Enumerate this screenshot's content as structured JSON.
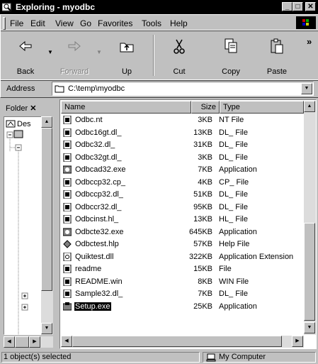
{
  "window": {
    "title": "Exploring - myodbc"
  },
  "caption_buttons": {
    "minimize": "_",
    "maximize": "□",
    "close": "✕"
  },
  "menu": [
    {
      "label": "File"
    },
    {
      "label": "Edit"
    },
    {
      "label": "View"
    },
    {
      "label": "Go"
    },
    {
      "label": "Favorites"
    },
    {
      "label": "Tools"
    },
    {
      "label": "Help"
    }
  ],
  "toolbar": {
    "back": {
      "label": "Back"
    },
    "forward": {
      "label": "Forward"
    },
    "up": {
      "label": "Up"
    },
    "cut": {
      "label": "Cut"
    },
    "copy": {
      "label": "Copy"
    },
    "paste": {
      "label": "Paste"
    },
    "more": "»"
  },
  "address": {
    "label": "Address",
    "value": "C:\\temp\\myodbc"
  },
  "folder_pane": {
    "header": "Folder",
    "close": "✕",
    "tree_item": "Des"
  },
  "columns": {
    "name": "Name",
    "size": "Size",
    "type": "Type"
  },
  "files": [
    {
      "name": "Odbc.nt",
      "size": "3KB",
      "type": "NT File",
      "icon": "generic-file-icon"
    },
    {
      "name": "Odbc16gt.dl_",
      "size": "13KB",
      "type": "DL_ File",
      "icon": "generic-file-icon"
    },
    {
      "name": "Odbc32.dl_",
      "size": "31KB",
      "type": "DL_ File",
      "icon": "generic-file-icon"
    },
    {
      "name": "Odbc32gt.dl_",
      "size": "3KB",
      "type": "DL_ File",
      "icon": "generic-file-icon"
    },
    {
      "name": "Odbcad32.exe",
      "size": "7KB",
      "type": "Application",
      "icon": "application-icon"
    },
    {
      "name": "Odbccp32.cp_",
      "size": "4KB",
      "type": "CP_ File",
      "icon": "generic-file-icon"
    },
    {
      "name": "Odbccp32.dl_",
      "size": "51KB",
      "type": "DL_ File",
      "icon": "generic-file-icon"
    },
    {
      "name": "Odbccr32.dl_",
      "size": "95KB",
      "type": "DL_ File",
      "icon": "generic-file-icon"
    },
    {
      "name": "Odbcinst.hl_",
      "size": "13KB",
      "type": "HL_ File",
      "icon": "generic-file-icon"
    },
    {
      "name": "Odbcte32.exe",
      "size": "645KB",
      "type": "Application",
      "icon": "application-icon"
    },
    {
      "name": "Odbctest.hlp",
      "size": "57KB",
      "type": "Help File",
      "icon": "help-file-icon"
    },
    {
      "name": "Quiktest.dll",
      "size": "322KB",
      "type": "Application Extension",
      "icon": "dll-file-icon"
    },
    {
      "name": "readme",
      "size": "15KB",
      "type": "File",
      "icon": "generic-file-icon"
    },
    {
      "name": "README.win",
      "size": "8KB",
      "type": "WIN File",
      "icon": "generic-file-icon"
    },
    {
      "name": "Sample32.dl_",
      "size": "7KB",
      "type": "DL_ File",
      "icon": "generic-file-icon"
    },
    {
      "name": "Setup.exe",
      "size": "25KB",
      "type": "Application",
      "icon": "setup-icon",
      "selected": true
    }
  ],
  "status": {
    "left": "1 object(s) selected",
    "right": "My Computer"
  },
  "colors": {
    "titlebar": "#000000",
    "face": "#c0c0c0",
    "selection": "#000000"
  }
}
